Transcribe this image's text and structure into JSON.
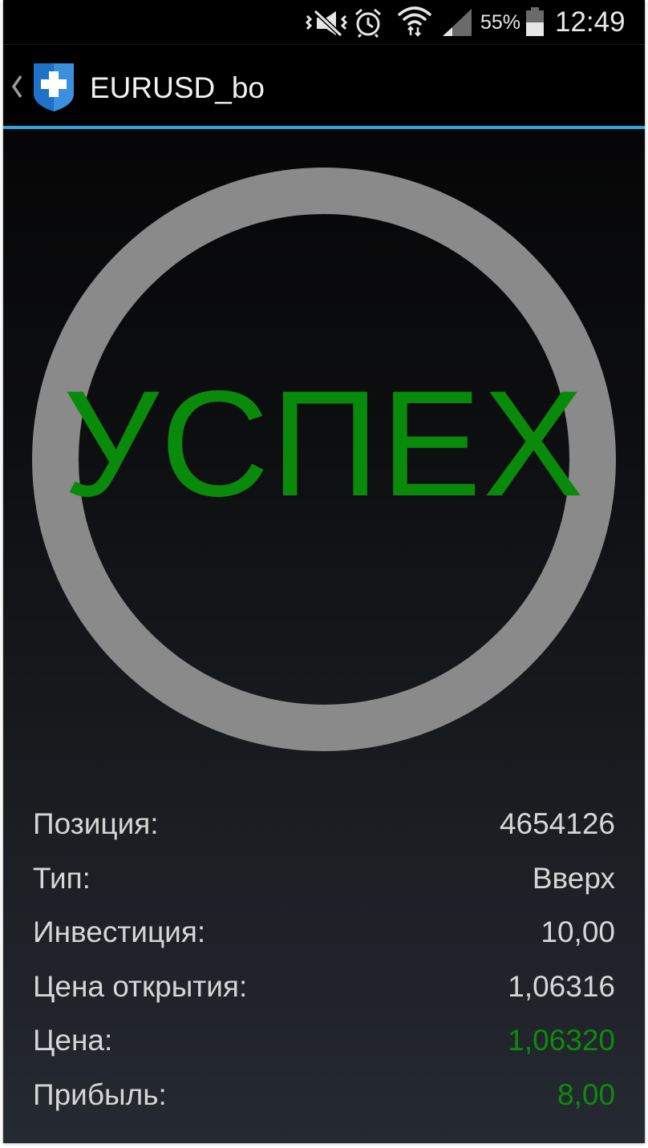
{
  "status_bar": {
    "battery_percent": "55%",
    "time": "12:49",
    "icons": [
      "vibrate-mute-icon",
      "alarm-icon",
      "wifi-icon",
      "signal-icon",
      "battery-icon"
    ]
  },
  "action_bar": {
    "title": "EURUSD_bo",
    "accent_color": "#2ea5e0"
  },
  "result": {
    "label": "УСПЕХ",
    "label_color": "#0a8a0a",
    "ring_color": "#8a8a8a"
  },
  "details": {
    "rows": [
      {
        "label": "Позиция:",
        "value": "4654126",
        "highlight": false
      },
      {
        "label": "Тип:",
        "value": "Вверх",
        "highlight": false
      },
      {
        "label": "Инвестиция:",
        "value": "10,00",
        "highlight": false
      },
      {
        "label": "Цена открытия:",
        "value": "1,06316",
        "highlight": false
      },
      {
        "label": "Цена:",
        "value": "1,06320",
        "highlight": true
      },
      {
        "label": "Прибыль:",
        "value": "8,00",
        "highlight": true
      }
    ],
    "highlight_color": "#0e8a0e"
  }
}
